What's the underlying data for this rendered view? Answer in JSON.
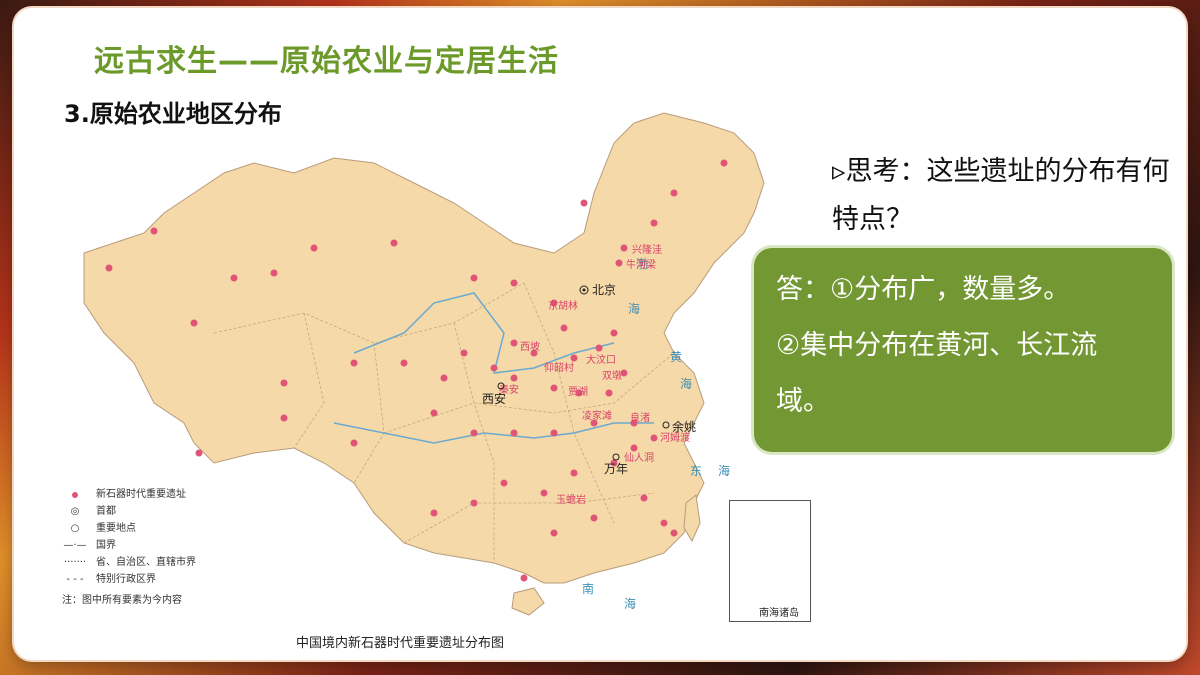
{
  "slide": {
    "title": "远古求生——原始农业与定居生活",
    "subtitle": "3.原始农业地区分布",
    "think_icon": "▹",
    "think": "思考：这些遗址的分布有何特点？",
    "answer_lines": [
      "答：①分布广，数量多。",
      "②集中分布在黄河、长江流域。"
    ]
  },
  "map": {
    "caption": "中国境内新石器时代重要遗址分布图",
    "inset_label": "南海诸岛",
    "cities": [
      "北京",
      "西安",
      "余姚",
      "万年"
    ],
    "sites": [
      "兴隆洼",
      "牛河梁",
      "东胡林",
      "大汶口",
      "西坡",
      "秦安",
      "仰韶村",
      "双墩",
      "贾湖",
      "凌家滩",
      "良渚",
      "河姆渡",
      "仙人洞",
      "玉蟾岩"
    ],
    "seas": [
      "渤",
      "海",
      "黄",
      "海",
      "东",
      "海",
      "南",
      "海",
      "南",
      "海"
    ],
    "legend": [
      {
        "symbol": "dot",
        "label": "新石器时代重要遗址"
      },
      {
        "symbol": "capital",
        "label": "首都"
      },
      {
        "symbol": "place",
        "label": "重要地点"
      },
      {
        "symbol": "border",
        "label": "国界"
      },
      {
        "symbol": "province",
        "label": "省、自治区、直辖市界"
      },
      {
        "symbol": "sar",
        "label": "特别行政区界"
      }
    ],
    "note": "注：图中所有要素为今内容"
  }
}
